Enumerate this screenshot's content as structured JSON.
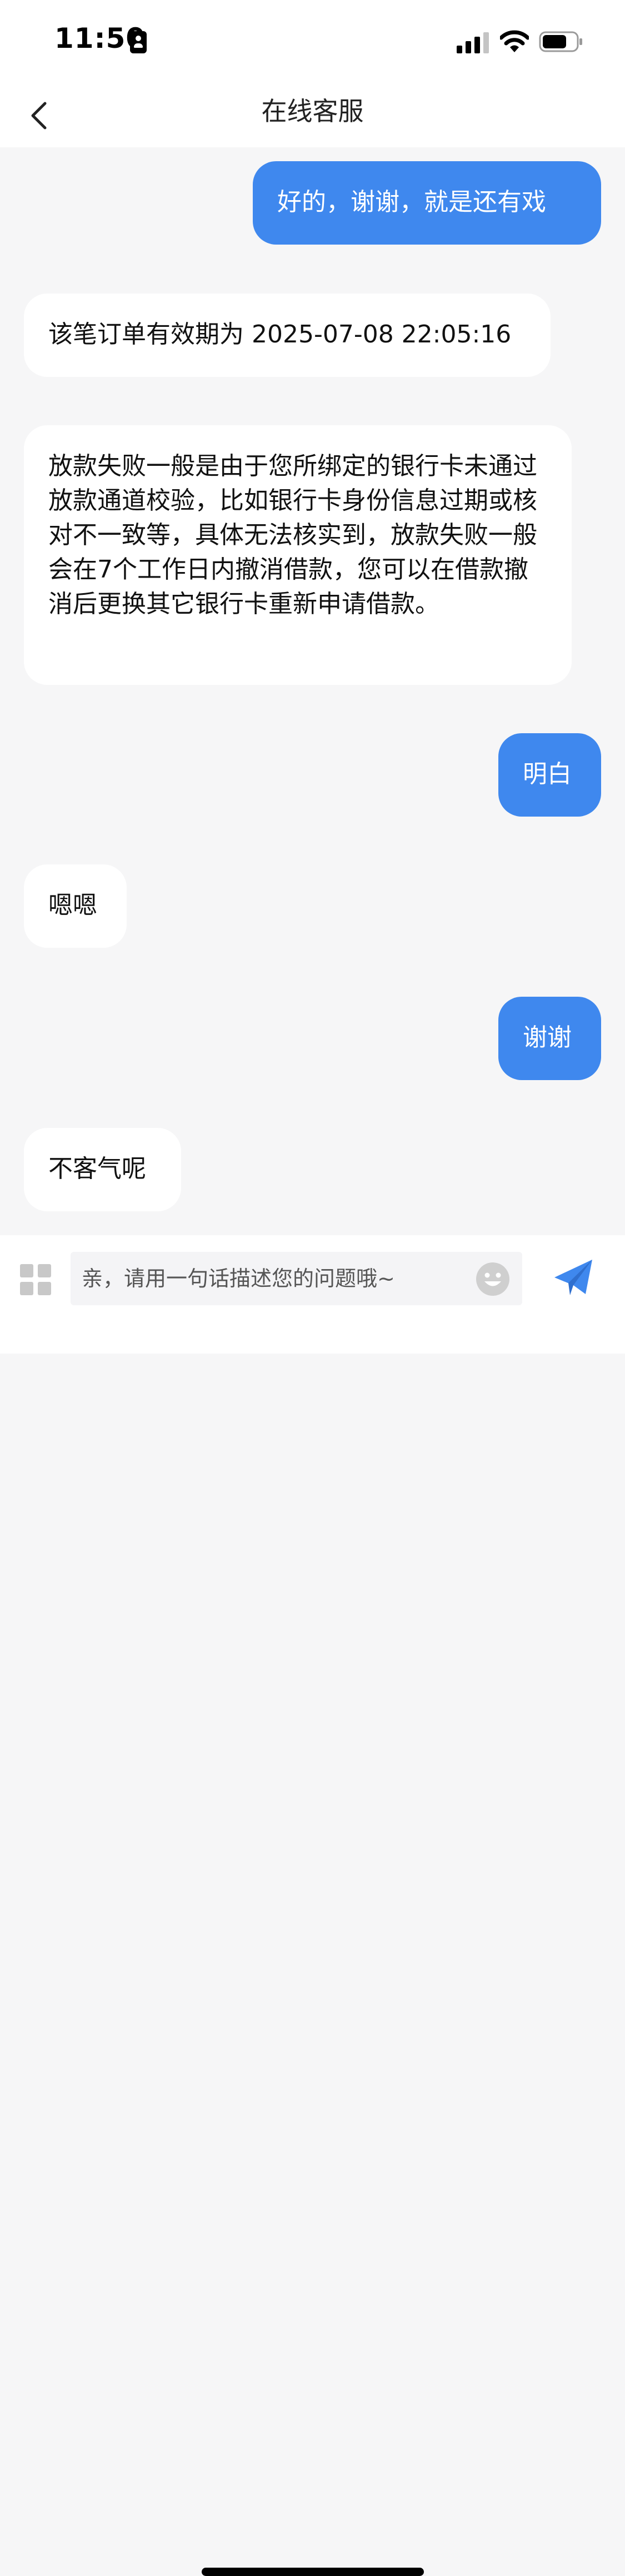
{
  "status_bar": {
    "time": "11:50"
  },
  "header": {
    "title": "在线客服"
  },
  "messages": [
    {
      "side": "user",
      "text": "好的，谢谢，就是还有戏"
    },
    {
      "side": "agent",
      "text": "该笔订单有效期为 2025-07-08 22:05:16"
    },
    {
      "side": "agent",
      "text": "放款失败一般是由于您所绑定的银行卡未通过放款通道校验，比如银行卡身份信息过期或核对不一致等，具体无法核实到，放款失败一般会在7个工作日内撤消借款，您可以在借款撤消后更换其它银行卡重新申请借款。"
    },
    {
      "side": "user",
      "text": "明白"
    },
    {
      "side": "agent",
      "text": "嗯嗯"
    },
    {
      "side": "user",
      "text": "谢谢"
    },
    {
      "side": "agent",
      "text": "不客气呢"
    }
  ],
  "input": {
    "placeholder": "亲，请用一句话描述您的问题哦~",
    "value": ""
  },
  "colors": {
    "user_bubble": "#3f88ee",
    "agent_bubble": "#ffffff",
    "background": "#f6f6f7",
    "send_icon": "#3f88ee"
  },
  "icons": {
    "back": "chevron-left-icon",
    "menu": "grid-icon",
    "emoji": "emoji-icon",
    "send": "paper-plane-icon"
  }
}
